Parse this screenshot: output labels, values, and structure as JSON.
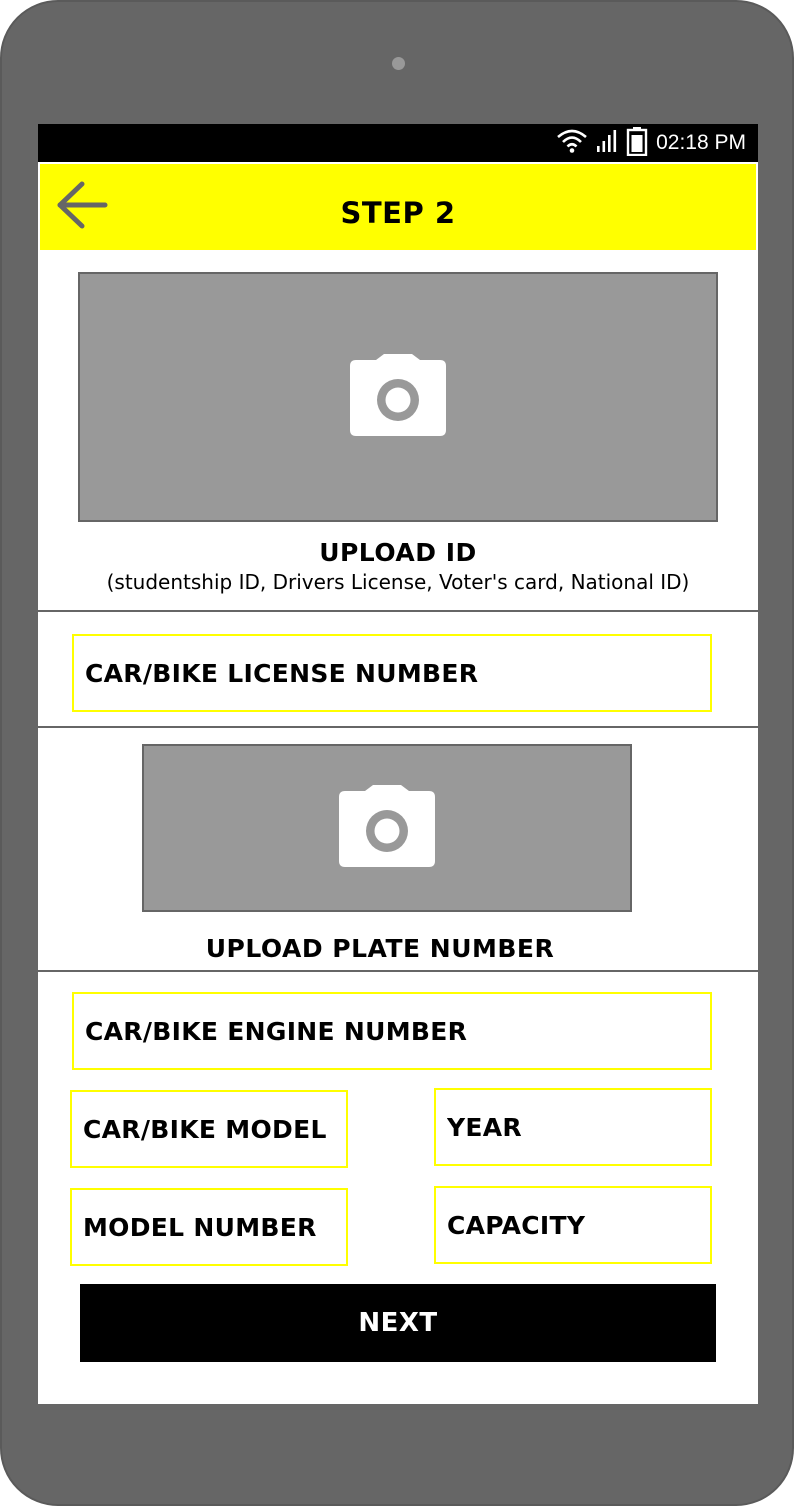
{
  "status_bar": {
    "time": "02:18 PM",
    "icons": [
      "wifi-icon",
      "signal-icon",
      "battery-icon"
    ]
  },
  "app_bar": {
    "title": "STEP 2",
    "back_icon": "arrow-left-icon",
    "background_color": "#ffff00"
  },
  "upload_id": {
    "icon": "camera-icon",
    "label": "UPLOAD ID",
    "subtitle": "(studentship ID, Drivers License, Voter's card, National ID)"
  },
  "fields": {
    "license_number": "CAR/BIKE LICENSE NUMBER",
    "engine_number": "CAR/BIKE ENGINE NUMBER",
    "model": "CAR/BIKE MODEL",
    "year": "YEAR",
    "model_number": "MODEL NUMBER",
    "capacity": "CAPACITY"
  },
  "upload_plate": {
    "icon": "camera-icon",
    "label": "UPLOAD PLATE NUMBER"
  },
  "next_button": {
    "label": "NEXT"
  },
  "colors": {
    "accent": "#ffff00",
    "device": "#666666",
    "photo_placeholder": "#999999",
    "button": "#000000"
  }
}
